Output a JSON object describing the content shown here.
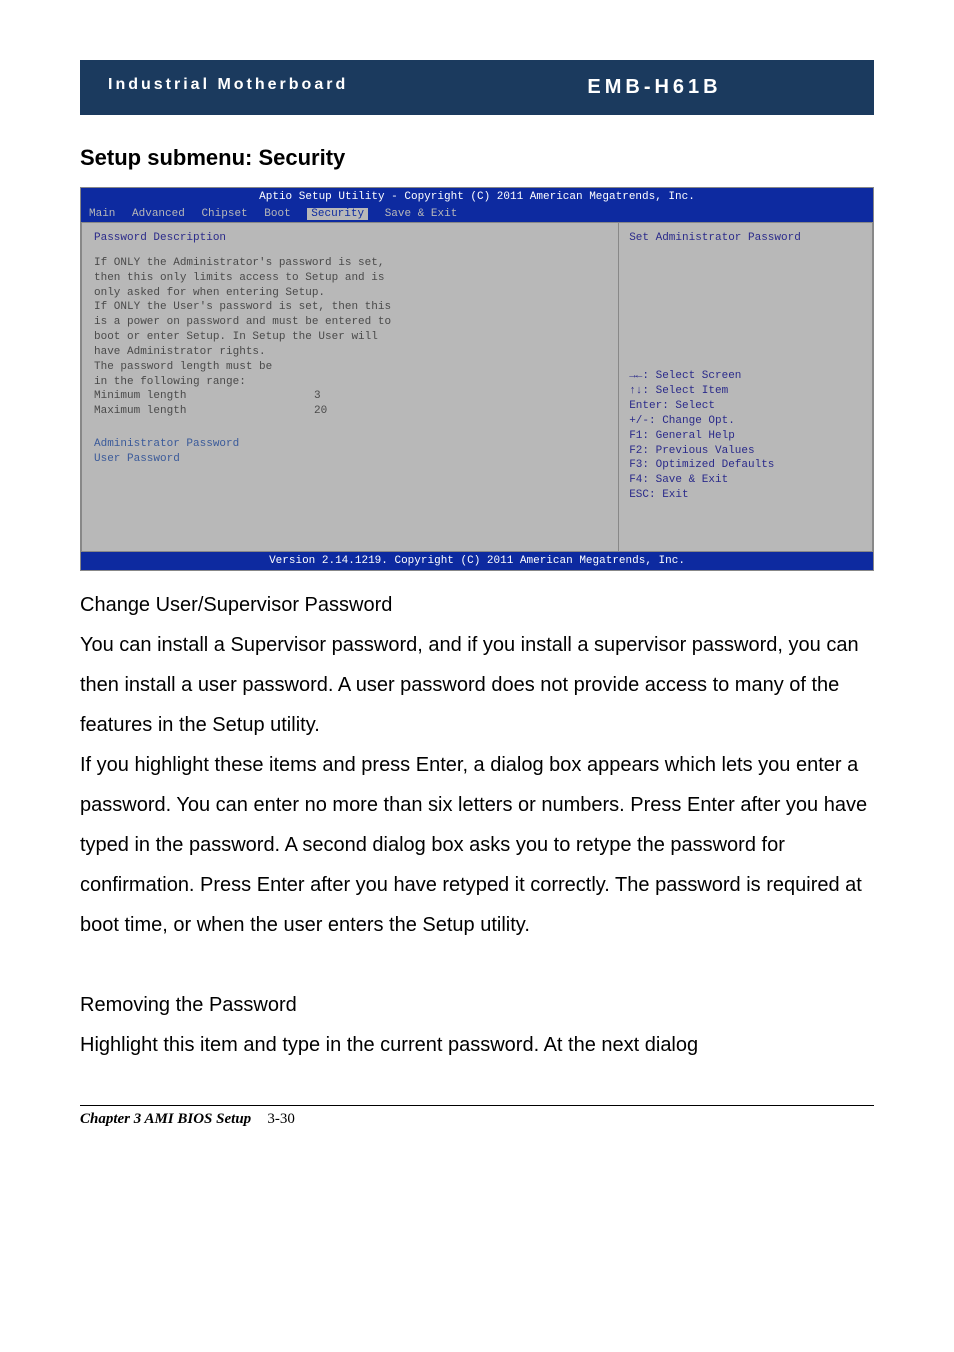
{
  "header": {
    "left": "Industrial Motherboard",
    "right": "EMB-H61B"
  },
  "sectionHeading": "Setup submenu: Security",
  "bios": {
    "topBar": "Aptio Setup Utility - Copyright (C) 2011 American Megatrends, Inc.",
    "menu": {
      "items": [
        "Main",
        "Advanced",
        "Chipset",
        "Boot"
      ],
      "selected": "Security",
      "after": "Save & Exit"
    },
    "left": {
      "title": "Password Description",
      "lines": [
        "If ONLY the Administrator's password is set,",
        "then this only limits access to Setup and is",
        "only asked for when entering Setup.",
        "If ONLY the User's password is set, then this",
        "is a power on password and must be entered to",
        "boot or enter Setup. In Setup the User will",
        "have Administrator rights.",
        "The password length must be",
        "in the following range:"
      ],
      "minLabel": "Minimum length",
      "minValue": "3",
      "maxLabel": "Maximum length",
      "maxValue": "20",
      "adminPw": "Administrator Password",
      "userPw": "User Password"
    },
    "right": {
      "helpTop": "Set Administrator Password",
      "keys": [
        "→←: Select Screen",
        "↑↓: Select Item",
        "Enter: Select",
        "+/-: Change Opt.",
        "F1: General Help",
        "F2: Previous Values",
        "F3: Optimized Defaults",
        "F4: Save & Exit",
        "ESC: Exit"
      ]
    },
    "bottomBar": "Version 2.14.1219. Copyright (C) 2011 American Megatrends, Inc."
  },
  "body": {
    "changeTitle": "Change User/Supervisor Password",
    "para1": "You can install a Supervisor password, and if you install a supervisor password, you can then install a user password.   A user password does not provide access to many of the features in the Setup utility.",
    "para2": "If you highlight these items and press Enter, a dialog box appears which lets you enter a password.   You can enter no more than six letters or numbers.   Press Enter after you have typed in the password.   A second dialog box asks you to retype the password for confirmation.   Press Enter after you have retyped it correctly.   The password is required at boot time, or when the user enters the Setup utility.",
    "removeTitle": "Removing the Password",
    "para3": "Highlight this item and type in the current password.   At the next dialog"
  },
  "footer": {
    "chapter": "Chapter 3 AMI BIOS Setup",
    "page": "3-30"
  }
}
